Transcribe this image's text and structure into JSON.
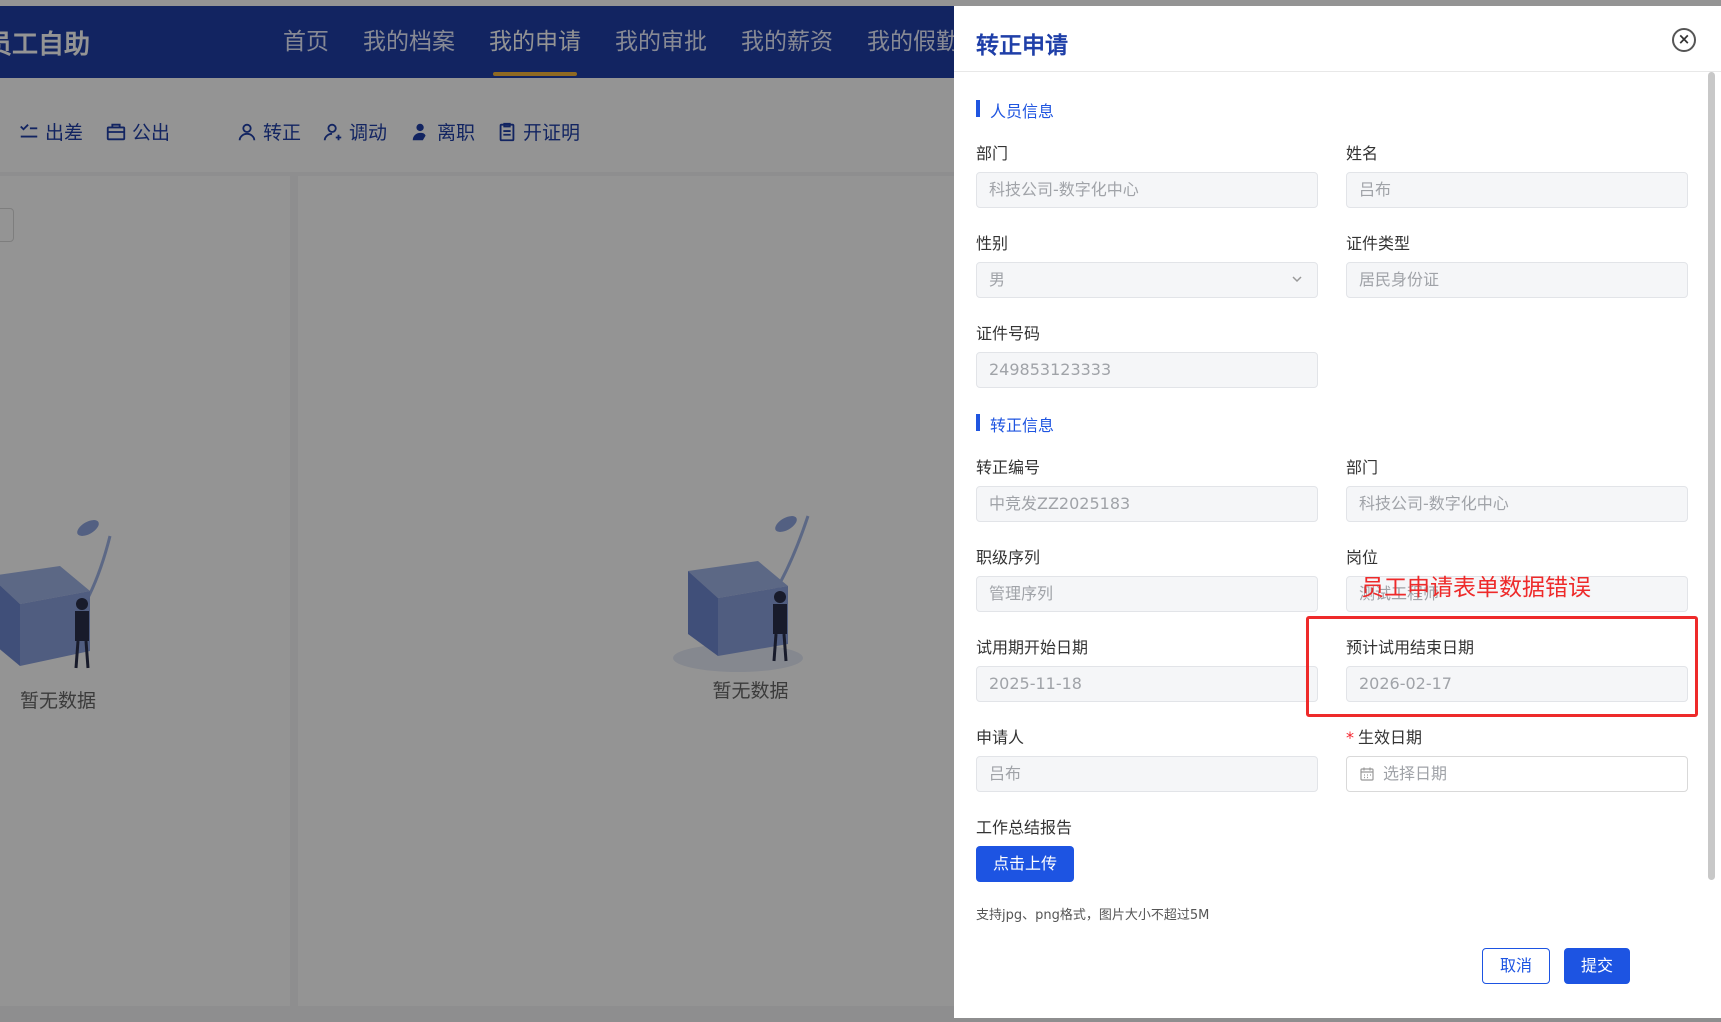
{
  "background": {
    "brand": "员工自助",
    "nav": [
      "首页",
      "我的档案",
      "我的申请",
      "我的审批",
      "我的薪资",
      "我的假勤"
    ],
    "active_nav": "我的申请",
    "toolbar": [
      "出差",
      "公出",
      "转正",
      "调动",
      "离职",
      "开证明"
    ],
    "empty_text": "暂无数据"
  },
  "drawer": {
    "title": "转正申请",
    "close_icon": "close-icon",
    "sections": {
      "personnel": "人员信息",
      "regularization": "转正信息"
    },
    "fields": {
      "dept": {
        "label": "部门",
        "value": "科技公司-数字化中心"
      },
      "name": {
        "label": "姓名",
        "value": "吕布"
      },
      "gender": {
        "label": "性别",
        "value": "男"
      },
      "id_type": {
        "label": "证件类型",
        "value": "居民身份证"
      },
      "id_no": {
        "label": "证件号码",
        "value": "249853123333"
      },
      "reg_no": {
        "label": "转正编号",
        "value": "中竞发ZZ2025183"
      },
      "reg_dept": {
        "label": "部门",
        "value": "科技公司-数字化中心"
      },
      "rank": {
        "label": "职级序列",
        "value": "管理序列"
      },
      "post": {
        "label": "岗位",
        "value": "测试工程师"
      },
      "probation_start": {
        "label": "试用期开始日期",
        "value": "2025-11-18"
      },
      "probation_end": {
        "label": "预计试用结束日期",
        "value": "2026-02-17"
      },
      "applicant": {
        "label": "申请人",
        "value": "吕布"
      },
      "effective_date": {
        "label": "生效日期",
        "required_mark": "*",
        "placeholder": "选择日期"
      },
      "report": {
        "label": "工作总结报告"
      }
    },
    "upload_button": "点击上传",
    "upload_hint": "支持jpg、png格式，图片大小不超过5M",
    "cancel": "取消",
    "submit": "提交"
  },
  "annotation": {
    "text": "员工申请表单数据错误",
    "color": "#ee2a2a"
  },
  "colors": {
    "primary": "#1d54e2",
    "nav_bg": "#1f3fa8",
    "active_underline": "#f5b53d"
  }
}
